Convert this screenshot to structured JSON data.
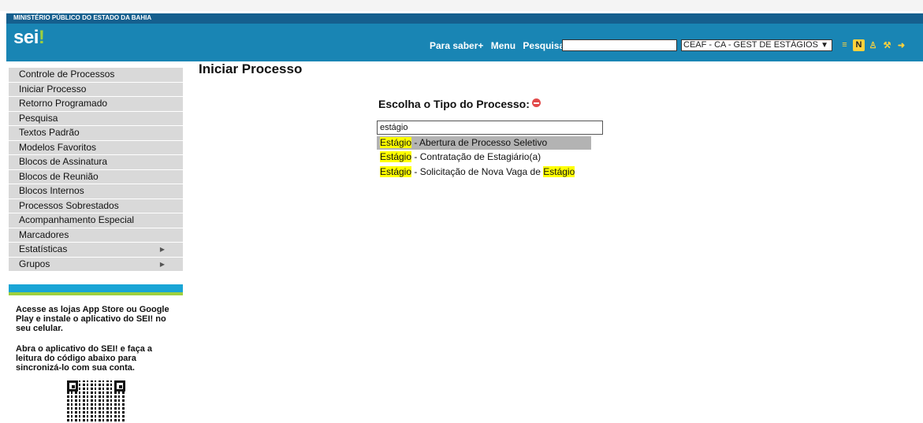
{
  "header": {
    "org": "MINISTÉRIO PÚBLICO DO ESTADO DA BAHIA",
    "logo": "sei",
    "logo_mark": "!",
    "links": [
      "Para saber+",
      "Menu",
      "Pesquisa"
    ],
    "search_value": "",
    "unit": "CEAF - CA - GEST DE ESTÁGIOS",
    "icons": [
      "list-icon",
      "notes-icon",
      "user-icon",
      "tools-icon",
      "exit-icon"
    ]
  },
  "sidebar": {
    "items": [
      "Controle de Processos",
      "Iniciar Processo",
      "Retorno Programado",
      "Pesquisa",
      "Textos Padrão",
      "Modelos Favoritos",
      "Blocos de Assinatura",
      "Blocos de Reunião",
      "Blocos Internos",
      "Processos Sobrestados",
      "Acompanhamento Especial",
      "Marcadores",
      "Estatísticas",
      "Grupos"
    ],
    "promo_1": "Acesse as lojas App Store ou Google Play e instale o aplicativo do SEI! no seu celular.",
    "promo_2": "Abra o aplicativo do SEI! e faça a leitura do código abaixo para sincronizá-lo com sua conta."
  },
  "main": {
    "title": "Iniciar Processo",
    "choose_label": "Escolha o Tipo do Processo:",
    "filter_value": "estágio",
    "results": [
      {
        "match": "Estágio",
        "rest": " - Abertura de Processo Seletivo"
      },
      {
        "match": "Estágio",
        "rest": " - Contratação de Estagiário(a)"
      },
      {
        "match": "Estágio",
        "rest": " - Solicitação de Nova Vaga de ",
        "tail_match": "Estágio"
      }
    ]
  }
}
